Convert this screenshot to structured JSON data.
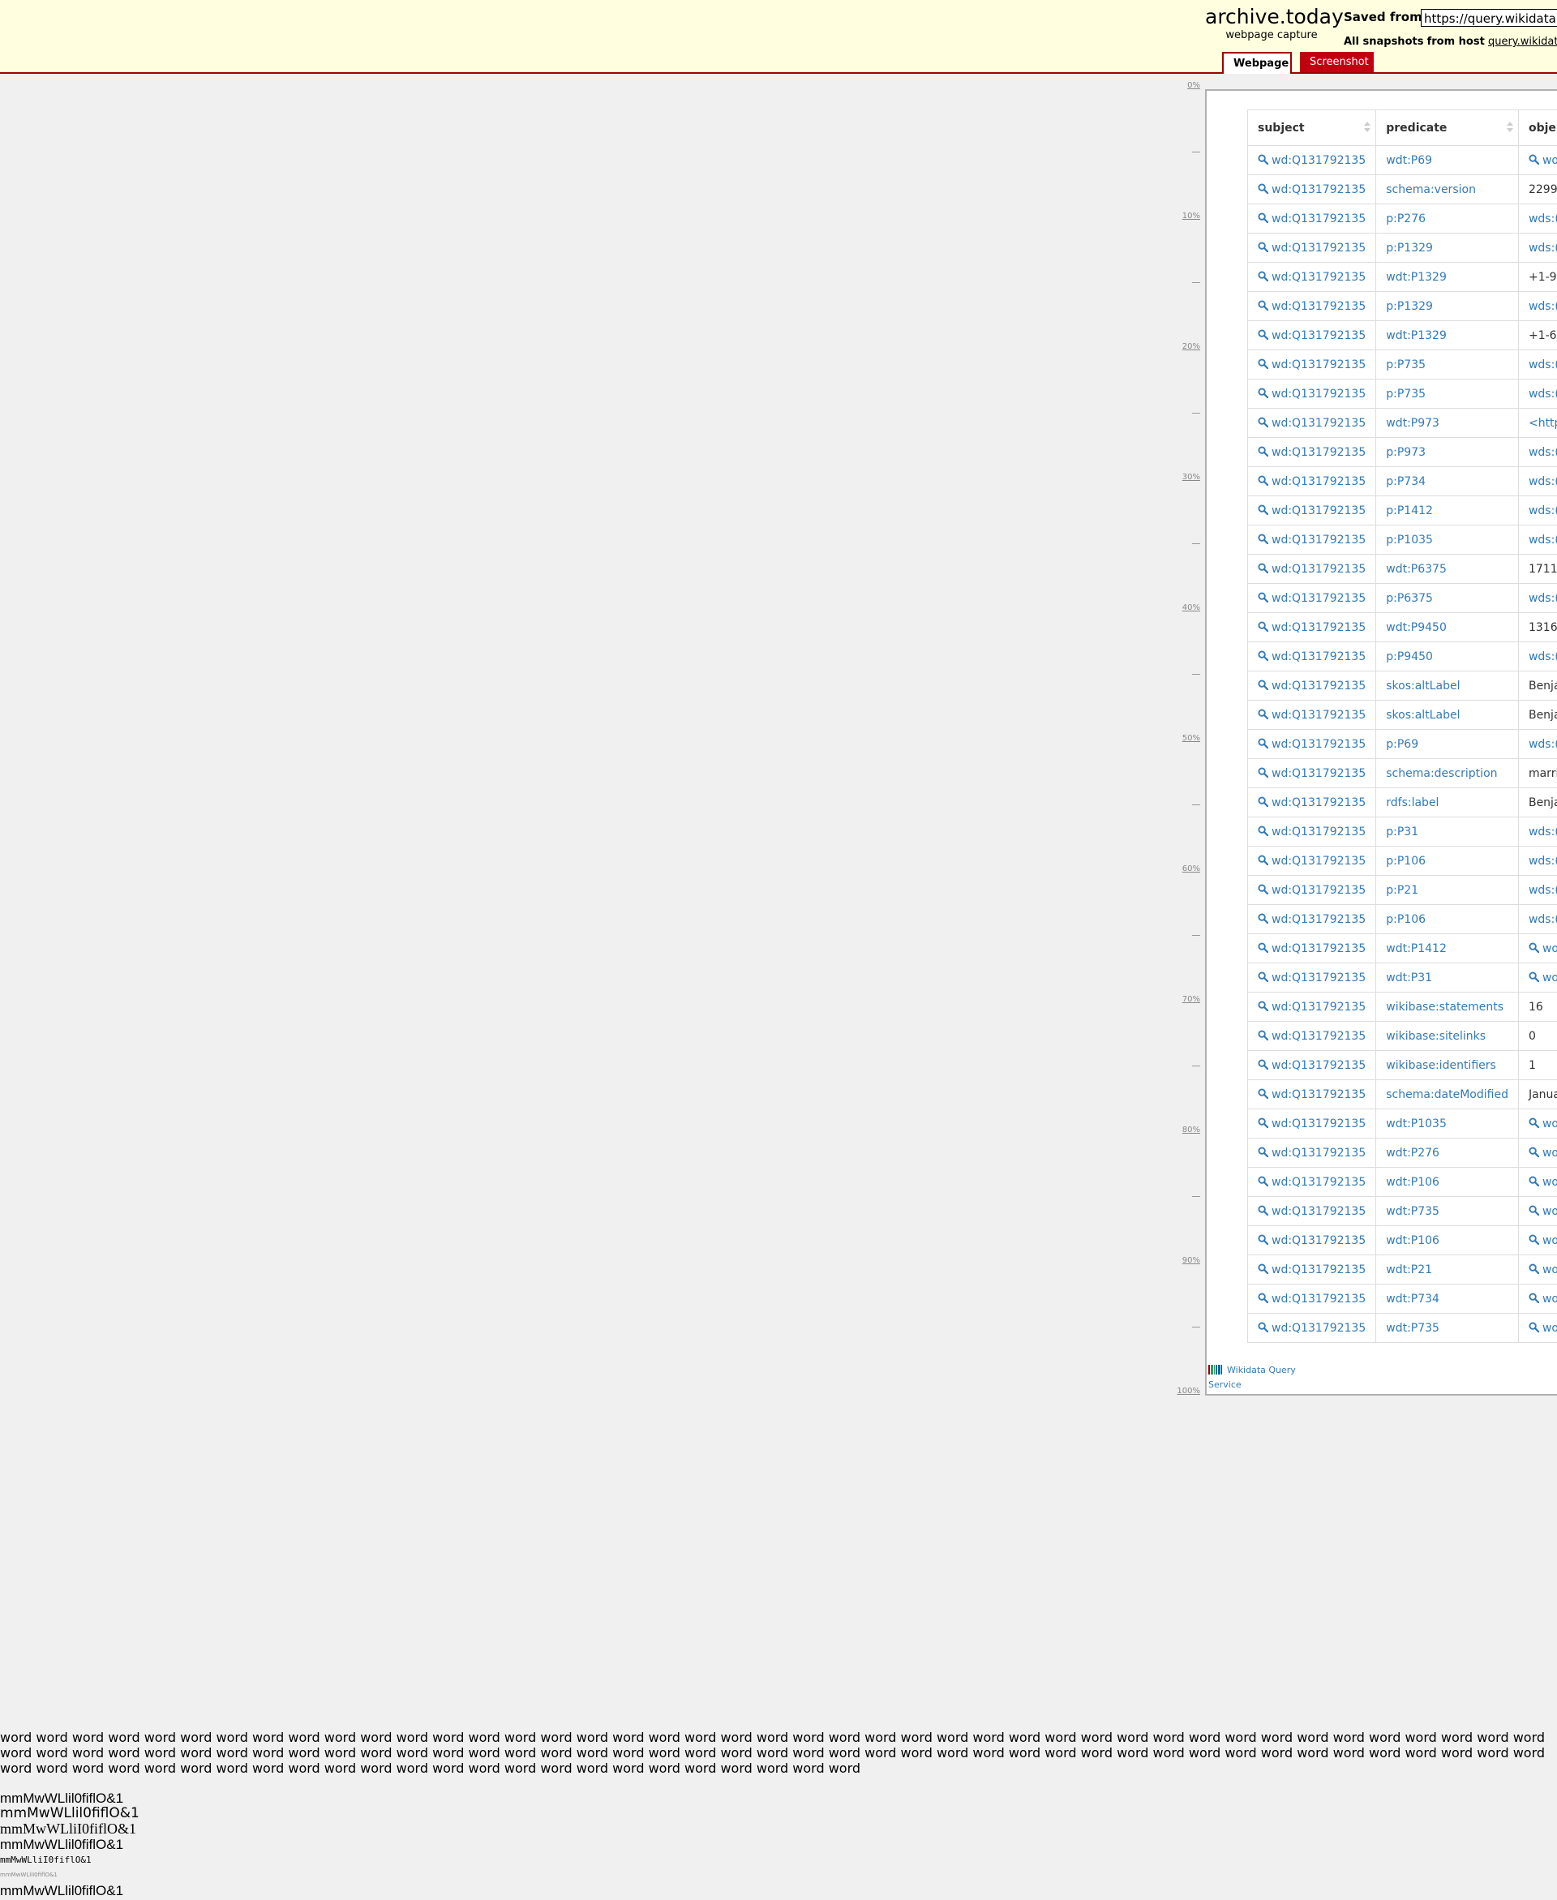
{
  "header": {
    "logo_name": "archive.today",
    "logo_sub": "webpage capture",
    "saved_from_label": "Saved from",
    "url_value": "https://query.wikidata.org",
    "all_snapshots_label": "All snapshots",
    "from_host_label": "from host",
    "host_link": "query.wikidata.c",
    "tabs": {
      "webpage": "Webpage",
      "screenshot": "Screenshot"
    }
  },
  "ruler": {
    "labels": [
      "0%",
      "10%",
      "20%",
      "30%",
      "40%",
      "50%",
      "60%",
      "70%",
      "80%",
      "90%",
      "100%"
    ]
  },
  "table": {
    "columns": [
      "subject",
      "predicate",
      "obje"
    ],
    "rows": [
      {
        "subject": "wd:Q131792135",
        "predicate": "wdt:P69",
        "object": "wo",
        "object_kind": "search"
      },
      {
        "subject": "wd:Q131792135",
        "predicate": "schema:version",
        "object": "2299",
        "object_kind": "plain"
      },
      {
        "subject": "wd:Q131792135",
        "predicate": "p:P276",
        "object": "wds:(",
        "object_kind": "link"
      },
      {
        "subject": "wd:Q131792135",
        "predicate": "p:P1329",
        "object": "wds:(",
        "object_kind": "link"
      },
      {
        "subject": "wd:Q131792135",
        "predicate": "wdt:P1329",
        "object": "+1-9",
        "object_kind": "plain"
      },
      {
        "subject": "wd:Q131792135",
        "predicate": "p:P1329",
        "object": "wds:(",
        "object_kind": "link"
      },
      {
        "subject": "wd:Q131792135",
        "predicate": "wdt:P1329",
        "object": "+1-6",
        "object_kind": "plain"
      },
      {
        "subject": "wd:Q131792135",
        "predicate": "p:P735",
        "object": "wds:(",
        "object_kind": "link"
      },
      {
        "subject": "wd:Q131792135",
        "predicate": "p:P735",
        "object": "wds:(",
        "object_kind": "link"
      },
      {
        "subject": "wd:Q131792135",
        "predicate": "wdt:P973",
        "object": "<http",
        "object_kind": "link"
      },
      {
        "subject": "wd:Q131792135",
        "predicate": "p:P973",
        "object": "wds:(",
        "object_kind": "link"
      },
      {
        "subject": "wd:Q131792135",
        "predicate": "p:P734",
        "object": "wds:(",
        "object_kind": "link"
      },
      {
        "subject": "wd:Q131792135",
        "predicate": "p:P1412",
        "object": "wds:(",
        "object_kind": "link"
      },
      {
        "subject": "wd:Q131792135",
        "predicate": "p:P1035",
        "object": "wds:(",
        "object_kind": "link"
      },
      {
        "subject": "wd:Q131792135",
        "predicate": "wdt:P6375",
        "object": "1711",
        "object_kind": "plain"
      },
      {
        "subject": "wd:Q131792135",
        "predicate": "p:P6375",
        "object": "wds:(",
        "object_kind": "link"
      },
      {
        "subject": "wd:Q131792135",
        "predicate": "wdt:P9450",
        "object": "1316",
        "object_kind": "plain"
      },
      {
        "subject": "wd:Q131792135",
        "predicate": "p:P9450",
        "object": "wds:(",
        "object_kind": "link"
      },
      {
        "subject": "wd:Q131792135",
        "predicate": "skos:altLabel",
        "object": "Benja",
        "object_kind": "plain"
      },
      {
        "subject": "wd:Q131792135",
        "predicate": "skos:altLabel",
        "object": "Benja",
        "object_kind": "plain"
      },
      {
        "subject": "wd:Q131792135",
        "predicate": "p:P69",
        "object": "wds:(",
        "object_kind": "link"
      },
      {
        "subject": "wd:Q131792135",
        "predicate": "schema:description",
        "object": "marri",
        "object_kind": "plain"
      },
      {
        "subject": "wd:Q131792135",
        "predicate": "rdfs:label",
        "object": "Benja",
        "object_kind": "plain"
      },
      {
        "subject": "wd:Q131792135",
        "predicate": "p:P31",
        "object": "wds:(",
        "object_kind": "link"
      },
      {
        "subject": "wd:Q131792135",
        "predicate": "p:P106",
        "object": "wds:(",
        "object_kind": "link"
      },
      {
        "subject": "wd:Q131792135",
        "predicate": "p:P21",
        "object": "wds:(",
        "object_kind": "link"
      },
      {
        "subject": "wd:Q131792135",
        "predicate": "p:P106",
        "object": "wds:(",
        "object_kind": "link"
      },
      {
        "subject": "wd:Q131792135",
        "predicate": "wdt:P1412",
        "object": "wo",
        "object_kind": "search"
      },
      {
        "subject": "wd:Q131792135",
        "predicate": "wdt:P31",
        "object": "wo",
        "object_kind": "search"
      },
      {
        "subject": "wd:Q131792135",
        "predicate": "wikibase:statements",
        "object": "16",
        "object_kind": "plain"
      },
      {
        "subject": "wd:Q131792135",
        "predicate": "wikibase:sitelinks",
        "object": "0",
        "object_kind": "plain"
      },
      {
        "subject": "wd:Q131792135",
        "predicate": "wikibase:identifiers",
        "object": "1",
        "object_kind": "plain"
      },
      {
        "subject": "wd:Q131792135",
        "predicate": "schema:dateModified",
        "object": "Janua",
        "object_kind": "plain"
      },
      {
        "subject": "wd:Q131792135",
        "predicate": "wdt:P1035",
        "object": "wo",
        "object_kind": "search"
      },
      {
        "subject": "wd:Q131792135",
        "predicate": "wdt:P276",
        "object": "wo",
        "object_kind": "search"
      },
      {
        "subject": "wd:Q131792135",
        "predicate": "wdt:P106",
        "object": "wo",
        "object_kind": "search"
      },
      {
        "subject": "wd:Q131792135",
        "predicate": "wdt:P735",
        "object": "wo",
        "object_kind": "search"
      },
      {
        "subject": "wd:Q131792135",
        "predicate": "wdt:P106",
        "object": "wo",
        "object_kind": "search"
      },
      {
        "subject": "wd:Q131792135",
        "predicate": "wdt:P21",
        "object": "wo",
        "object_kind": "search"
      },
      {
        "subject": "wd:Q131792135",
        "predicate": "wdt:P734",
        "object": "wo",
        "object_kind": "search"
      },
      {
        "subject": "wd:Q131792135",
        "predicate": "wdt:P735",
        "object": "wo",
        "object_kind": "search"
      }
    ]
  },
  "wdqs_logo_text": "Wikidata Query Service",
  "bottom": {
    "word": "word",
    "word_count": 110,
    "samples": [
      "mmMwWLlil0fiflO&1",
      "mmMwWLlil0fiflO&1",
      "mmMwWLliI0fiflO&1",
      "mmMwWLlil0fiflO&1",
      "mmMwWLliI0fiflO&1",
      "mmMwWLliI0fiflO&1",
      "mmMwWLlil0fiflO&1"
    ]
  },
  "colors": {
    "header_bg": "#ffffe0",
    "accent_red": "#a00000",
    "link_blue": "#337ab7",
    "page_bg": "#f0f0f0"
  }
}
